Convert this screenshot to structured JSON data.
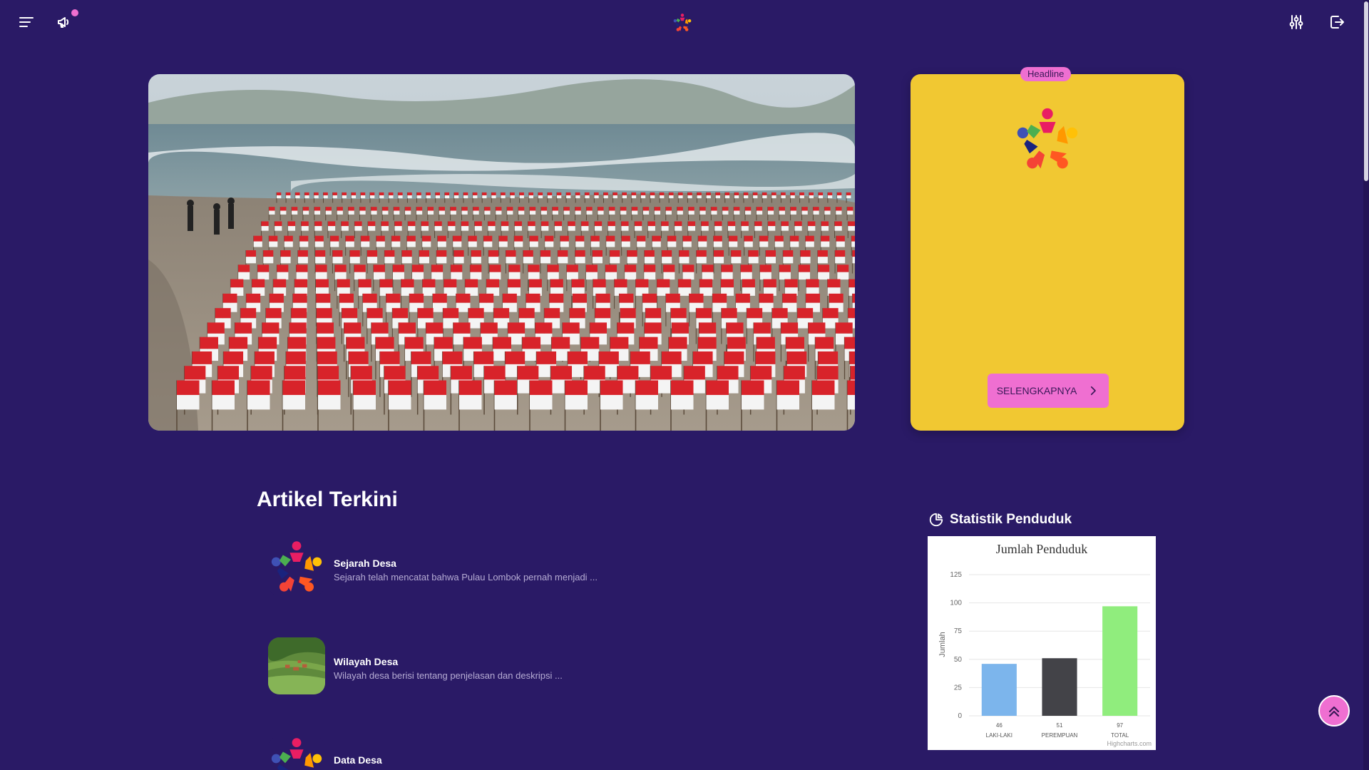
{
  "header": {
    "menu_icon": "hamburger-menu-icon",
    "announce_icon": "megaphone-icon",
    "logo_icon": "colorful-people-logo-icon",
    "settings_icon": "sliders-icon",
    "logout_icon": "logout-icon"
  },
  "headline": {
    "badge": "Headline",
    "button_label": "SELENGKAPNYA"
  },
  "articles": {
    "section_title": "Artikel Terkini",
    "items": [
      {
        "title": "Sejarah Desa",
        "desc": "Sejarah telah mencatat bahwa Pulau Lombok pernah menjadi ..."
      },
      {
        "title": "Wilayah Desa",
        "desc": "Wilayah desa berisi tentang penjelasan dan deskripsi ..."
      },
      {
        "title": "Data Desa",
        "desc": ""
      }
    ]
  },
  "stats": {
    "title": "Statistik Penduduk"
  },
  "chart_data": {
    "type": "bar",
    "title": "Jumlah Penduduk",
    "ylabel": "Jumlah",
    "xlabel": "",
    "categories": [
      "LAKI-LAKI",
      "PEREMPUAN",
      "TOTAL"
    ],
    "values": [
      46,
      51,
      97
    ],
    "data_labels": [
      "46",
      "51",
      "97"
    ],
    "colors": [
      "#7cb5ec",
      "#434348",
      "#90ed7d"
    ],
    "ylim": [
      0,
      125
    ],
    "yticks": [
      "0",
      "25",
      "50",
      "75",
      "100",
      "125"
    ],
    "grid": true,
    "credit": "Highcharts.com"
  },
  "colors": {
    "background": "#2a1a66",
    "headline_card": "#f1c832",
    "accent_pink": "#ef6fd1"
  }
}
